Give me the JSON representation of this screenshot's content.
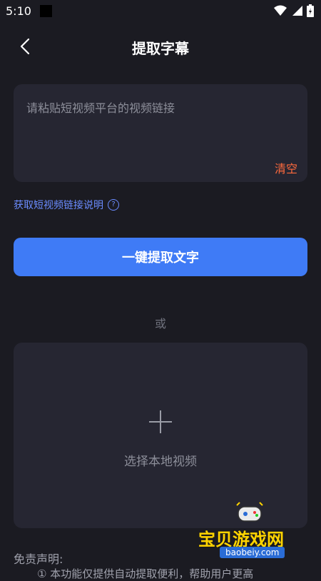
{
  "status_bar": {
    "time": "5:10"
  },
  "header": {
    "title": "提取字幕"
  },
  "input": {
    "placeholder": "请粘贴短视频平台的视频链接",
    "value": "",
    "clear_label": "清空"
  },
  "help": {
    "label": "获取短视频链接说明",
    "icon": "question-circle-icon"
  },
  "extract_button": {
    "label": "一键提取文字"
  },
  "separator": {
    "label": "或"
  },
  "local": {
    "label": "选择本地视频",
    "icon": "plus-icon"
  },
  "disclaimer": {
    "title": "免责声明:",
    "text": "① 本功能仅提供自动提取便利，帮助用户更高"
  },
  "watermark": {
    "text": "宝贝游戏网",
    "domain": "baobeiy.com"
  },
  "colors": {
    "accent": "#3f7bf6",
    "clear": "#ff6a3d",
    "link": "#6b8cff",
    "background": "#1b1b22",
    "card": "#262632"
  }
}
